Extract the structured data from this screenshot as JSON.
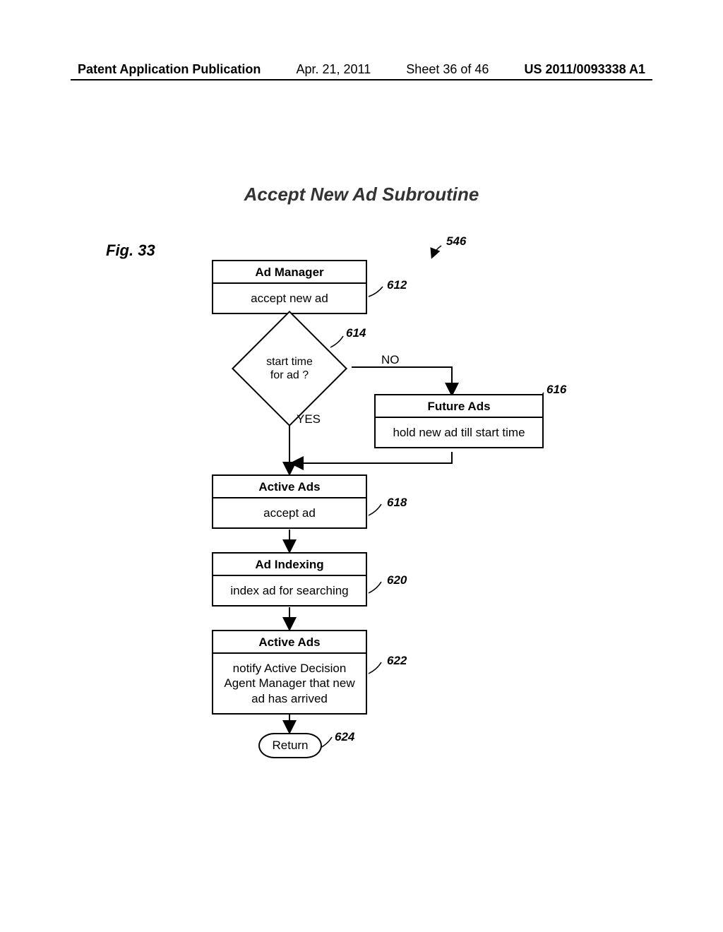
{
  "header": {
    "publication": "Patent Application Publication",
    "date": "Apr. 21, 2011",
    "sheet": "Sheet 36 of 46",
    "docnum": "US 2011/0093338 A1"
  },
  "title": "Accept New Ad Subroutine",
  "figure_label": "Fig. 33",
  "refs": {
    "entry": "546",
    "b612": "612",
    "b614": "614",
    "b616": "616",
    "b618": "618",
    "b620": "620",
    "b622": "622",
    "b624": "624"
  },
  "edges": {
    "no": "NO",
    "yes": "YES"
  },
  "boxes": {
    "b612": {
      "title": "Ad Manager",
      "body": "accept new ad"
    },
    "b614": {
      "body": "start time\nfor ad ?"
    },
    "b616": {
      "title": "Future Ads",
      "body": "hold new ad till start time"
    },
    "b618": {
      "title": "Active Ads",
      "body": "accept ad"
    },
    "b620": {
      "title": "Ad Indexing",
      "body": "index ad for searching"
    },
    "b622": {
      "title": "Active Ads",
      "body": "notify Active Decision Agent Manager that new ad has arrived"
    },
    "b624": {
      "body": "Return"
    }
  }
}
